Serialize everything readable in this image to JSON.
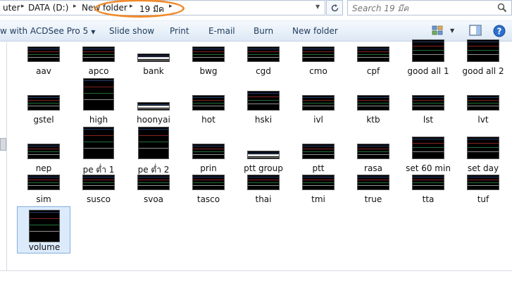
{
  "address": {
    "crumbs": [
      "uter",
      "DATA (D:)",
      "New folder",
      "19 มีค"
    ],
    "separators": [
      "▸",
      "▸",
      "▸",
      "▸"
    ]
  },
  "search": {
    "placeholder": "Search 19 มีค"
  },
  "toolbar": {
    "open_with": "w with ACDSee Pro 5",
    "slide_show": "Slide show",
    "print": "Print",
    "email": "E-mail",
    "burn": "Burn",
    "new_folder": "New folder"
  },
  "files": [
    {
      "name": "aav",
      "style": "wide"
    },
    {
      "name": "apco",
      "style": "wide"
    },
    {
      "name": "bank",
      "style": "band"
    },
    {
      "name": "bwg",
      "style": "wide"
    },
    {
      "name": "cgd",
      "style": "wide"
    },
    {
      "name": "cmo",
      "style": "wide"
    },
    {
      "name": "cpf",
      "style": "wide"
    },
    {
      "name": "good all 1",
      "style": "tall"
    },
    {
      "name": "good all 2",
      "style": "tall"
    },
    {
      "name": "gstel",
      "style": "wide"
    },
    {
      "name": "high",
      "style": "portrait"
    },
    {
      "name": "hoonyai",
      "style": "band"
    },
    {
      "name": "hot",
      "style": "wide"
    },
    {
      "name": "hski",
      "style": "tallwide"
    },
    {
      "name": "ivl",
      "style": "wide"
    },
    {
      "name": "ktb",
      "style": "wide"
    },
    {
      "name": "lst",
      "style": "wide"
    },
    {
      "name": "lvt",
      "style": "wide"
    },
    {
      "name": "nep",
      "style": "wide"
    },
    {
      "name": "pe ต่ำ 1",
      "style": "portrait"
    },
    {
      "name": "pe ต่ำ 2",
      "style": "portrait"
    },
    {
      "name": "prin",
      "style": "wide"
    },
    {
      "name": "ptt group",
      "style": "band"
    },
    {
      "name": "ptt",
      "style": "wide"
    },
    {
      "name": "rasa",
      "style": "wide"
    },
    {
      "name": "set 60 min",
      "style": "tall"
    },
    {
      "name": "set day",
      "style": "tall"
    },
    {
      "name": "sim",
      "style": "wide"
    },
    {
      "name": "susco",
      "style": "wide"
    },
    {
      "name": "svoa",
      "style": "wide"
    },
    {
      "name": "tasco",
      "style": "wide"
    },
    {
      "name": "thai",
      "style": "wide"
    },
    {
      "name": "tmi",
      "style": "wide"
    },
    {
      "name": "true",
      "style": "wide"
    },
    {
      "name": "tta",
      "style": "wide"
    },
    {
      "name": "tuf",
      "style": "wide"
    },
    {
      "name": "volume",
      "style": "portrait",
      "selected": true
    }
  ],
  "colors": {
    "accent_oval": "#f08a2a",
    "selection_bg": "#dcebfc",
    "selection_border": "#84acdd",
    "toolbar_text": "#1e3a5c"
  }
}
